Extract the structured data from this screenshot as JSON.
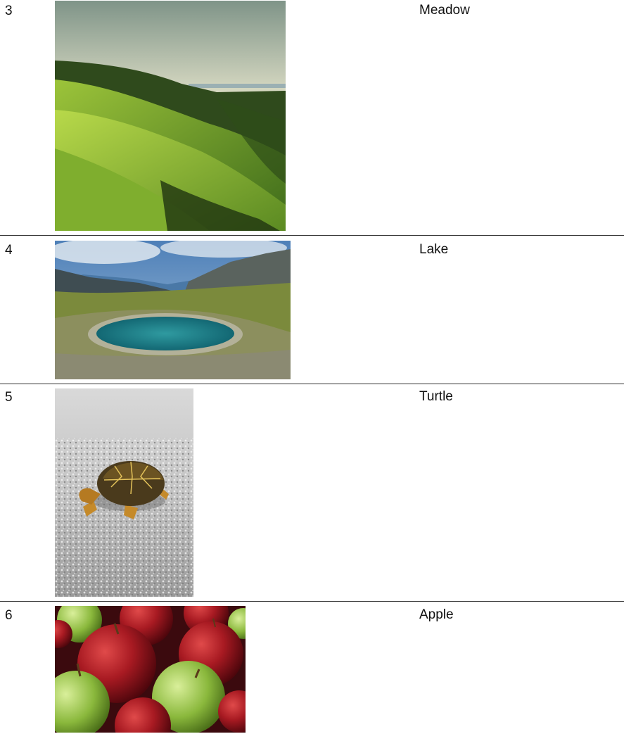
{
  "rows": [
    {
      "number": "3",
      "caption": "Meadow"
    },
    {
      "number": "4",
      "caption": "Lake"
    },
    {
      "number": "5",
      "caption": "Turtle"
    },
    {
      "number": "6",
      "caption": "Apple"
    }
  ]
}
